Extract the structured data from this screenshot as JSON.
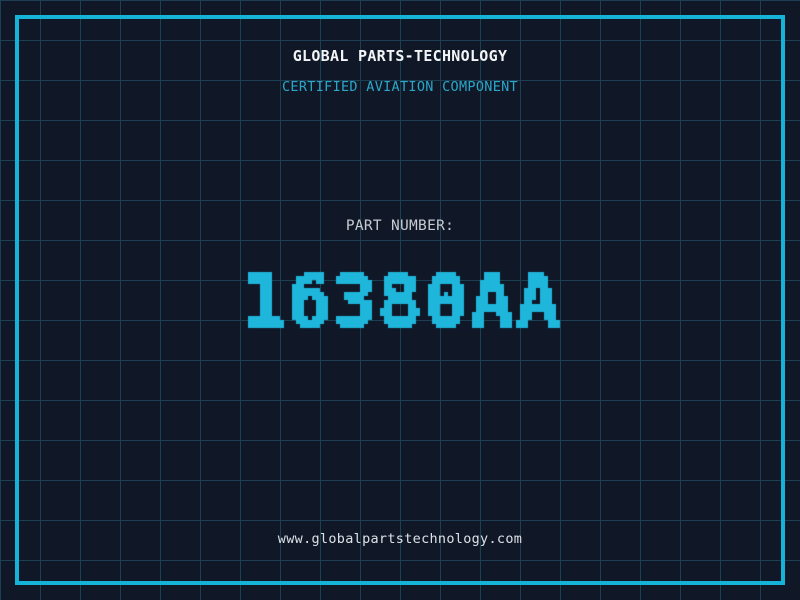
{
  "theme": {
    "background": "#101828",
    "grid_line": "#1b4054",
    "frame_color": "#16b3d9",
    "part_number_color": "#1fb6dc",
    "subtitle_color": "#2ba6c9",
    "title_color": "#f2f4f6",
    "label_color": "#c7ccd3",
    "url_color": "#dde1e6"
  },
  "header": {
    "title": "GLOBAL PARTS-TECHNOLOGY",
    "subtitle": "CERTIFIED AVIATION COMPONENT"
  },
  "part": {
    "label": "PART NUMBER:",
    "number": "16380AA"
  },
  "footer": {
    "url": "www.globalpartstechnology.com"
  }
}
